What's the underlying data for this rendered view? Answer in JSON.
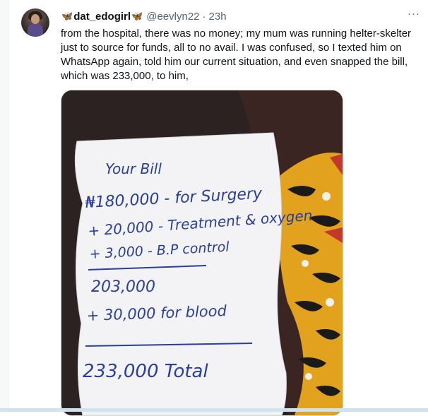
{
  "tweet": {
    "author": {
      "prefix_emoji": "🦋",
      "display_name": "dat_edogirl",
      "suffix_emoji": "🦋",
      "handle": "@eevlyn22",
      "separator": "·",
      "time": "23h"
    },
    "more_icon": "ellipsis-icon",
    "more_label": "···",
    "text": "from the hospital, there was no money; my mum was running helter-skelter just to source for funds, all to no avail. I was confused, so I texted him on WhatsApp again, told him our current situation, and even snapped the bill, which was 233,000, to him,"
  },
  "photo": {
    "lines": [
      "Your Bill",
      "₦180,000 - for Surgery",
      "+ 20,000 - Treatment & oxygen",
      "+ 3,000 - B.P control",
      "203,000",
      "+ 30,000 for blood",
      "233,000 Total"
    ]
  },
  "colors": {
    "accent": "#1d9bf0",
    "ink": "#2a3ea0",
    "text": "#0f1419",
    "muted": "#536471"
  }
}
